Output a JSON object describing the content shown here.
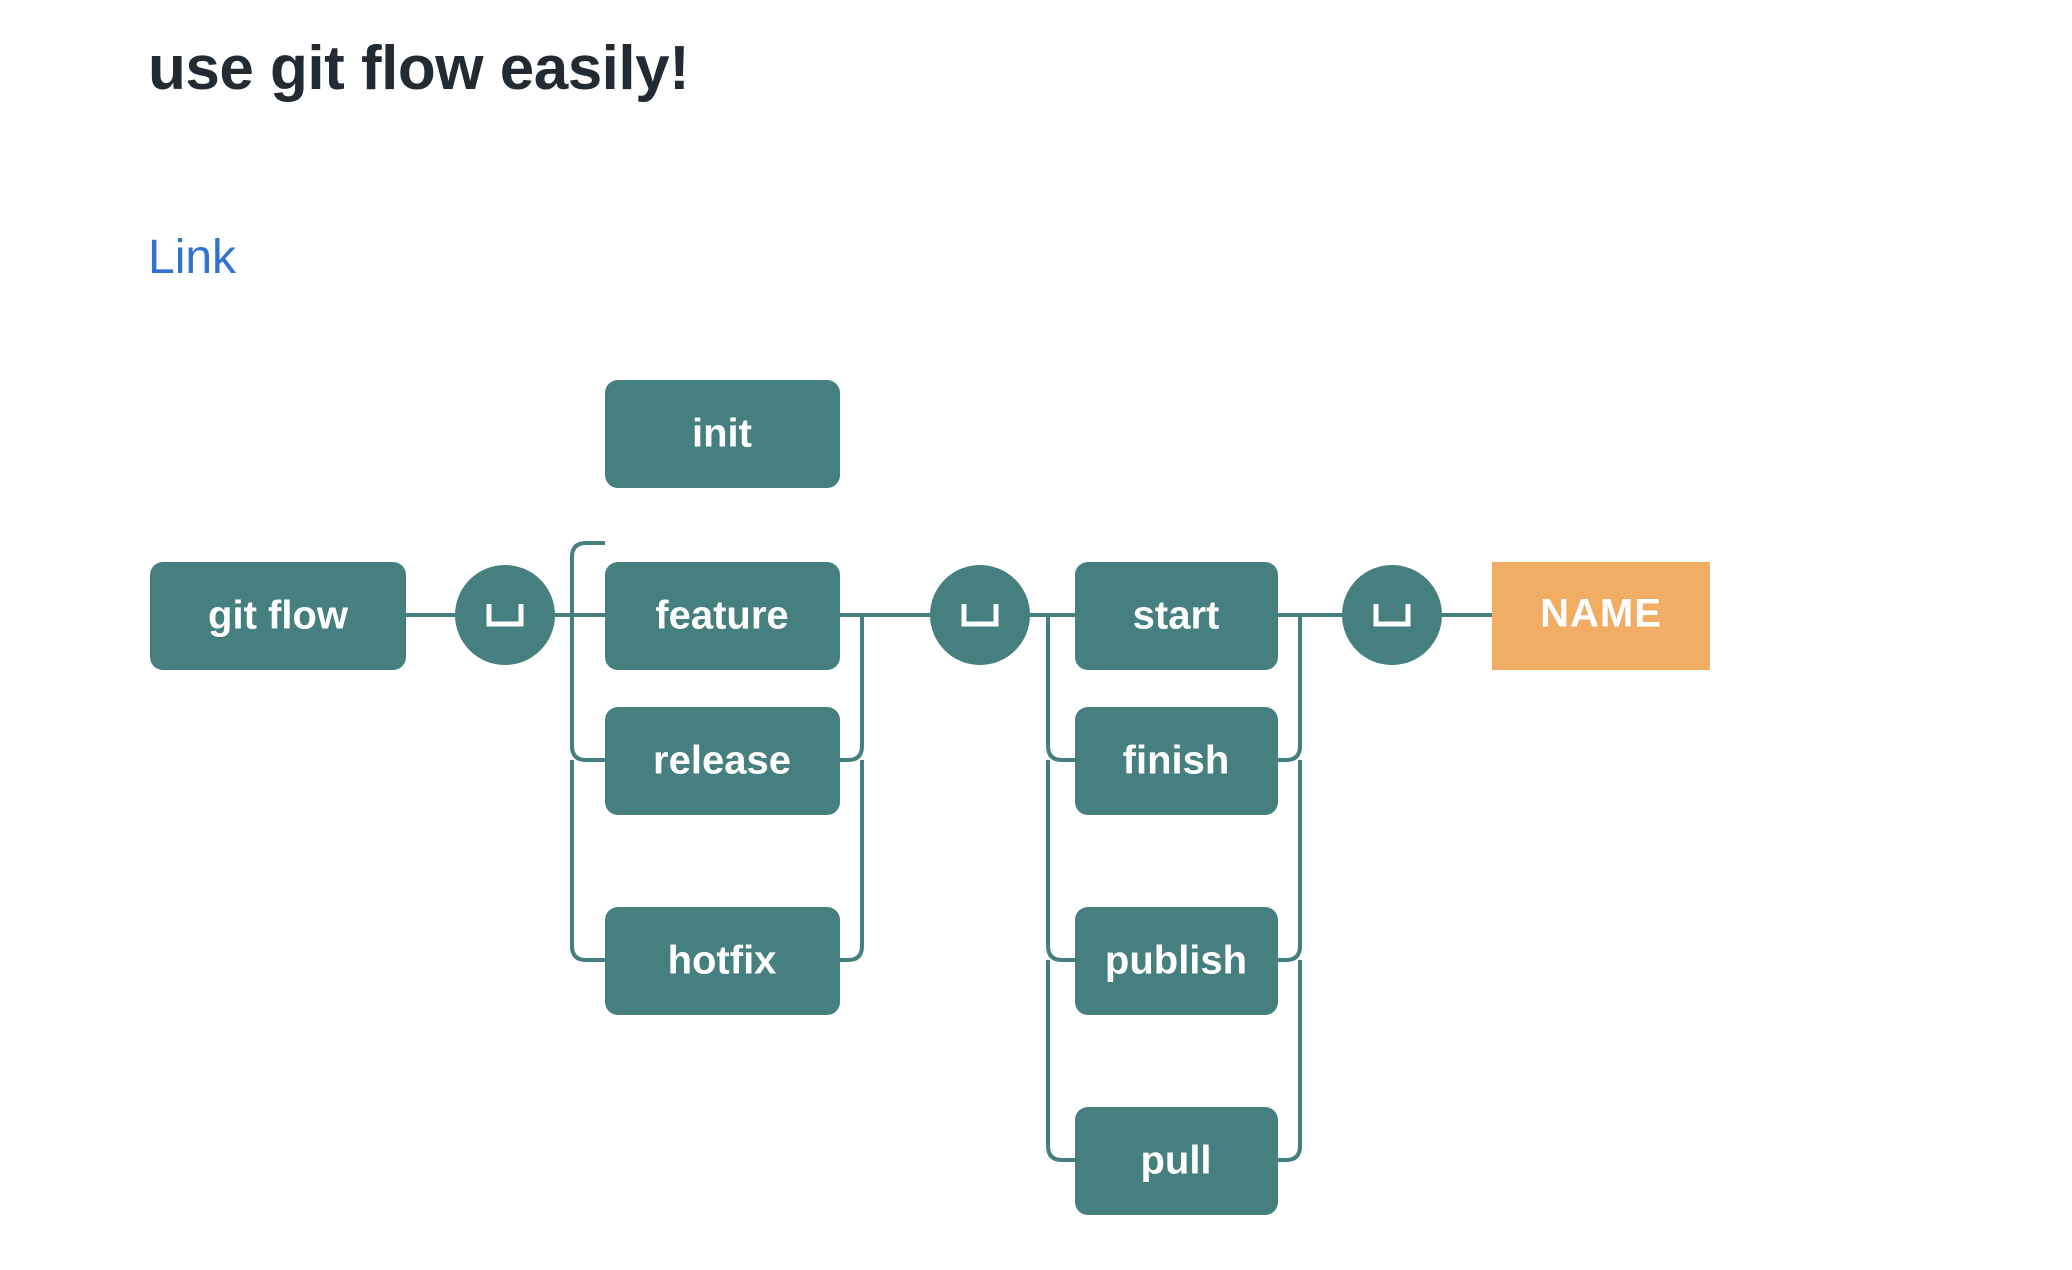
{
  "page": {
    "title": "use git flow easily!",
    "link_label": "Link",
    "background_color": "#ffffff",
    "title_color": "#242a31",
    "link_color": "#3073d0"
  },
  "diagram": {
    "name": "git-flow-railroad-diagram",
    "type": "railroad",
    "colors": {
      "terminal": "#457f7f",
      "nonterminal": "#f0ad63",
      "line": "#457f7f",
      "text": "#ffffff"
    },
    "start_node": {
      "label": "git flow",
      "kind": "literal"
    },
    "separators": [
      {
        "label": "space",
        "glyph": "␣"
      },
      {
        "label": "space",
        "glyph": "␣"
      },
      {
        "label": "space",
        "glyph": "␣"
      }
    ],
    "groups": [
      {
        "name": "subcommand-group",
        "options": [
          {
            "label": "init",
            "kind": "literal",
            "has_continuation": false
          },
          {
            "label": "feature",
            "kind": "literal",
            "has_continuation": true
          },
          {
            "label": "release",
            "kind": "literal",
            "has_continuation": true
          },
          {
            "label": "hotfix",
            "kind": "literal",
            "has_continuation": true
          }
        ]
      },
      {
        "name": "action-group",
        "options": [
          {
            "label": "start",
            "kind": "literal",
            "has_continuation": true
          },
          {
            "label": "finish",
            "kind": "literal",
            "has_continuation": true
          },
          {
            "label": "publish",
            "kind": "literal",
            "has_continuation": true
          },
          {
            "label": "pull",
            "kind": "literal",
            "has_continuation": true
          }
        ]
      }
    ],
    "end_node": {
      "label": "NAME",
      "kind": "placeholder"
    }
  }
}
